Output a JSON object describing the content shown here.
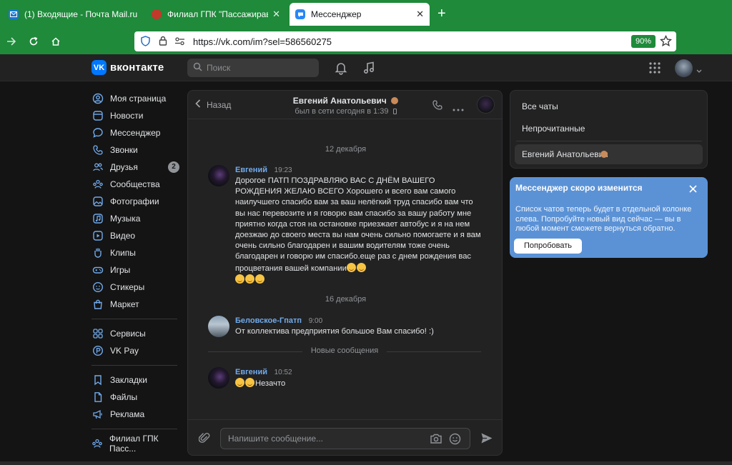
{
  "browser": {
    "tabs": [
      {
        "label": "(1) Входящие - Почта Mail.ru",
        "icon": "mail-icon",
        "active": false
      },
      {
        "label": "Филиал ГПК \"Пассажиравтотр",
        "icon": "emblem-icon",
        "active": false
      },
      {
        "label": "Мессенджер",
        "icon": "messenger-icon",
        "active": true
      }
    ],
    "new_tab": "+",
    "url": "https://vk.com/im?sel=586560275",
    "zoom": "90%"
  },
  "header": {
    "logo_text": "вконтакте",
    "logo_badge": "VK",
    "search_placeholder": "Поиск"
  },
  "menu": {
    "group1": [
      {
        "label": "Моя страница",
        "icon": "user-circle-icon"
      },
      {
        "label": "Новости",
        "icon": "news-icon"
      },
      {
        "label": "Мессенджер",
        "icon": "message-icon"
      },
      {
        "label": "Звонки",
        "icon": "phone-icon"
      },
      {
        "label": "Друзья",
        "icon": "friends-icon",
        "badge": "2"
      },
      {
        "label": "Сообщества",
        "icon": "communities-icon"
      },
      {
        "label": "Фотографии",
        "icon": "photo-icon"
      },
      {
        "label": "Музыка",
        "icon": "music-icon"
      },
      {
        "label": "Видео",
        "icon": "video-icon"
      },
      {
        "label": "Клипы",
        "icon": "clips-icon"
      },
      {
        "label": "Игры",
        "icon": "gamepad-icon"
      },
      {
        "label": "Стикеры",
        "icon": "sticker-icon"
      },
      {
        "label": "Маркет",
        "icon": "market-icon"
      }
    ],
    "group2": [
      {
        "label": "Сервисы",
        "icon": "services-icon"
      },
      {
        "label": "VK Pay",
        "icon": "vkpay-icon"
      }
    ],
    "group3": [
      {
        "label": "Закладки",
        "icon": "bookmark-icon"
      },
      {
        "label": "Файлы",
        "icon": "file-icon"
      },
      {
        "label": "Реклама",
        "icon": "megaphone-icon"
      }
    ],
    "group4": [
      {
        "label": "Филиал ГПК Пасс...",
        "icon": "group-icon"
      }
    ]
  },
  "chat": {
    "back_label": "Назад",
    "peer_name": "Евгений Анатольевич",
    "peer_status": "был в сети сегодня в 1:39",
    "date1": "12 декабря",
    "msg1": {
      "author": "Евгений",
      "time": "19:23",
      "text": "Дорогое ПАТП ПОЗДРАВЛЯЮ ВАС С ДНЁМ ВАШЕГО РОЖДЕНИЯ ЖЕЛАЮ ВСЕГО Хорошего и всего вам самого наилучшего спасибо вам за ваш нелёгкий труд спасибо вам что вы нас перевозите и я говорю вам спасибо за вашу работу мне приятно когда стоя на остановке приезжает автобус и я на нем доезжаю до своего места вы нам очень сильно помогаете и я вам очень сильно благодарен и вашим водителям тоже очень благодарен и говорю им спасибо.еще раз с днем рождения вас процветания вашей компании"
    },
    "date2": "16 декабря",
    "msg2": {
      "author": "Беловское-Гпатп",
      "time": "9:00",
      "text": "От коллектива предприятия большое Вам спасибо! :)"
    },
    "new_messages_label": "Новые сообщения",
    "msg3": {
      "author": "Евгений",
      "time": "10:52",
      "text": "Незачто"
    },
    "composer_placeholder": "Напишите сообщение..."
  },
  "folders": {
    "all": "Все чаты",
    "unread": "Непрочитанные",
    "selected": "Евгений Анатольевич"
  },
  "promo": {
    "title": "Мессенджер скоро изменится",
    "text": "Список чатов теперь будет в отдельной колонке слева. Попробуйте новый вид сейчас — вы в любой момент сможете вернуться обратно.",
    "button": "Попробовать"
  },
  "colors": {
    "browser_green": "#1e8a3a",
    "vk_blue": "#0077ff",
    "link_blue": "#71aaeb",
    "promo_blue": "#5b92d6",
    "background": "#141414",
    "panel": "#222222"
  }
}
